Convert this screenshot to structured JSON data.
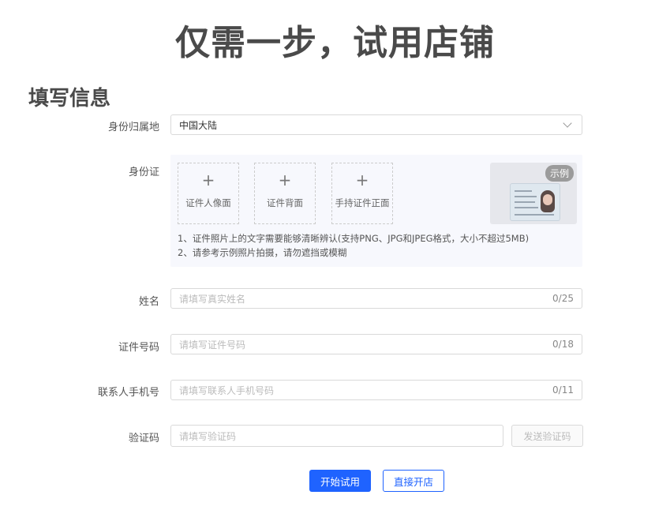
{
  "hero_title": "仅需一步，试用店铺",
  "section_title": "填写信息",
  "form": {
    "region": {
      "label": "身份归属地",
      "value": "中国大陆"
    },
    "id_card": {
      "label": "身份证",
      "uploads": [
        {
          "label": "证件人像面"
        },
        {
          "label": "证件背面"
        },
        {
          "label": "手持证件正面"
        }
      ],
      "plus_symbol": "+",
      "sample_badge": "示例",
      "notes": [
        "1、证件照片上的文字需要能够清晰辨认(支持PNG、JPG和JPEG格式，大小不超过5MB)",
        "2、请参考示例照片拍摄，请勿遮挡或模糊"
      ]
    },
    "name": {
      "label": "姓名",
      "placeholder": "请填写真实姓名",
      "counter": "0/25"
    },
    "id_number": {
      "label": "证件号码",
      "placeholder": "请填写证件号码",
      "counter": "0/18"
    },
    "phone": {
      "label": "联系人手机号",
      "placeholder": "请填写联系人手机号码",
      "counter": "0/11"
    },
    "sms": {
      "label": "验证码",
      "placeholder": "请填写验证码",
      "send_label": "发送验证码"
    }
  },
  "actions": {
    "start_trial": "开始试用",
    "open_store": "直接开店"
  },
  "colors": {
    "primary": "#1f63ff"
  }
}
